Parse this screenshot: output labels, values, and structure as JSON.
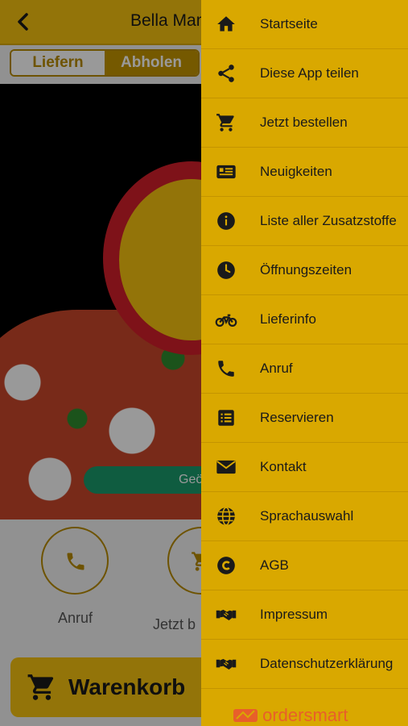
{
  "app": {
    "title": "Bella Mam",
    "tabs": [
      "Liefern",
      "Abholen"
    ],
    "active_tab": "Abholen",
    "hero_button_label": "Geö",
    "actions": [
      {
        "label": "Anruf",
        "icon": "phone-icon"
      },
      {
        "label": "Jetzt b",
        "icon": "cart-icon"
      }
    ],
    "cart_label": "Warenkorb"
  },
  "drawer": {
    "items": [
      {
        "label": "Startseite",
        "icon": "home-icon"
      },
      {
        "label": "Diese App teilen",
        "icon": "share-icon"
      },
      {
        "label": "Jetzt bestellen",
        "icon": "cart-icon"
      },
      {
        "label": "Neuigkeiten",
        "icon": "news-icon"
      },
      {
        "label": "Liste aller Zusatzstoffe",
        "icon": "info-icon"
      },
      {
        "label": "Öffnungszeiten",
        "icon": "clock-icon"
      },
      {
        "label": "Lieferinfo",
        "icon": "motorbike-icon"
      },
      {
        "label": "Anruf",
        "icon": "phone-icon"
      },
      {
        "label": "Reservieren",
        "icon": "list-icon"
      },
      {
        "label": "Kontakt",
        "icon": "mail-icon"
      },
      {
        "label": "Sprachauswahl",
        "icon": "globe-icon"
      },
      {
        "label": "AGB",
        "icon": "copyright-icon"
      },
      {
        "label": "Impressum",
        "icon": "handshake-icon"
      },
      {
        "label": "Datenschutzerklärung",
        "icon": "handshake-icon"
      }
    ],
    "footer_brand_a": "order",
    "footer_brand_b": "smart"
  },
  "colors": {
    "brand_yellow": "#f5c20f",
    "drawer_yellow": "#d9a800",
    "accent_gold": "#b78a00",
    "green": "#1a9a6b",
    "brand_orange": "#e85f2a"
  }
}
